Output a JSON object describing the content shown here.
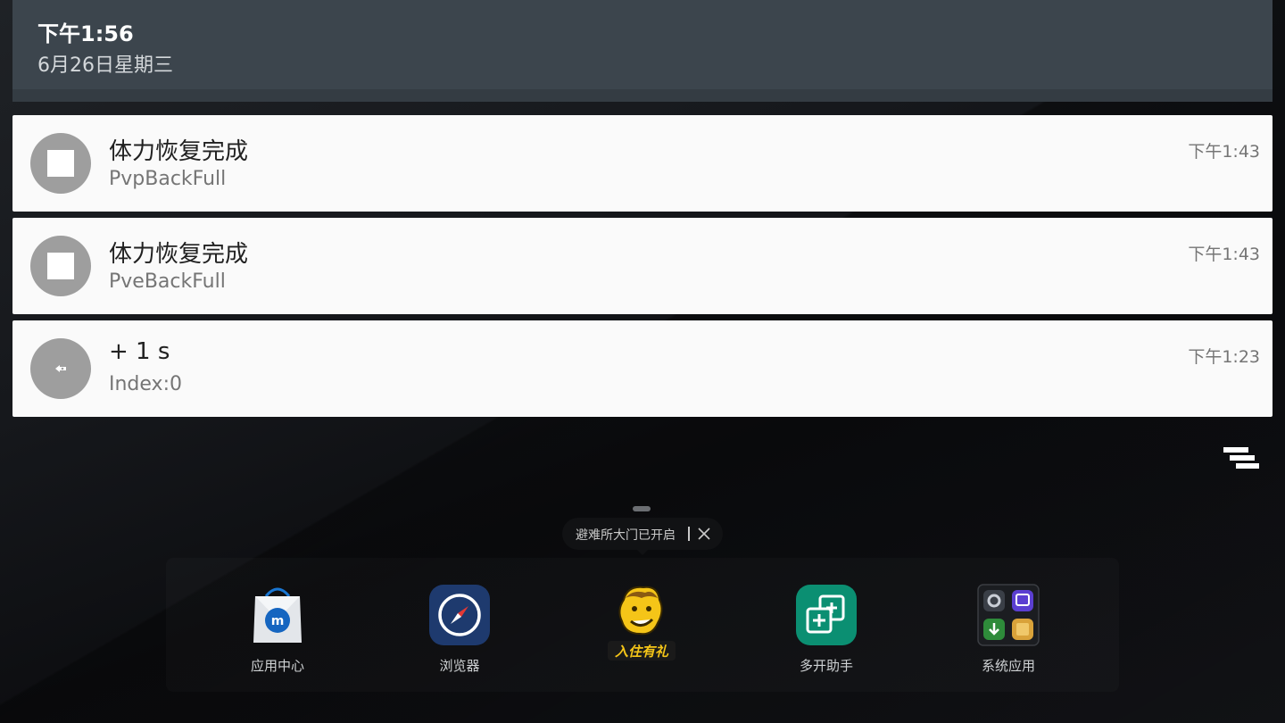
{
  "status_header": {
    "time": "下午1:56",
    "date": "6月26日星期三"
  },
  "notifications": [
    {
      "title": "体力恢复完成",
      "text": "PvpBackFull",
      "time": "下午1:43",
      "icon": "app-square-icon"
    },
    {
      "title": "体力恢复完成",
      "text": "PveBackFull",
      "time": "下午1:43",
      "icon": "app-square-icon"
    },
    {
      "title": "+ 1 s",
      "text": "Index:0",
      "time": "下午1:23",
      "icon": "small-glyph-icon"
    }
  ],
  "clear_all": {
    "icon": "clear-all-icon"
  },
  "tooltip": {
    "text": "避难所大门已开启",
    "icon": "close-icon"
  },
  "dock": {
    "apps": [
      {
        "label": "应用中心",
        "icon": "app-store-bag-icon",
        "color": "#1565c0"
      },
      {
        "label": "浏览器",
        "icon": "compass-browser-icon",
        "color": "#1e3a6e"
      },
      {
        "label": "入住有礼",
        "icon": "vault-boy-game-icon",
        "color": "#f5c518"
      },
      {
        "label": "多开助手",
        "icon": "multi-open-icon",
        "color": "#0b8f72"
      },
      {
        "label": "系统应用",
        "icon": "system-apps-folder-icon",
        "color": "#2a2d33"
      }
    ]
  },
  "colors": {
    "header_bg": "#3c454d",
    "card_bg": "#fafafa",
    "icon_circle": "#9e9e9e"
  }
}
